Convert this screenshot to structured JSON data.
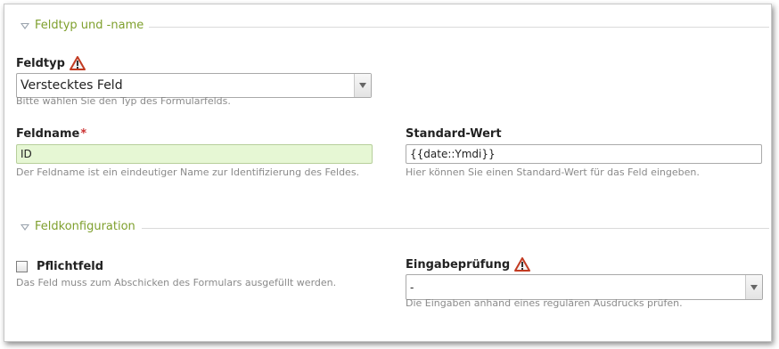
{
  "sections": {
    "feldtyp": {
      "legend": "Feldtyp und -name"
    },
    "konfig": {
      "legend": "Feldkonfiguration"
    }
  },
  "feldtyp": {
    "label": "Feldtyp",
    "value": "Verstecktes Feld",
    "help": "Bitte wählen Sie den Typ des Formularfelds."
  },
  "feldname": {
    "label": "Feldname",
    "required_mark": "*",
    "value": "ID",
    "help": "Der Feldname ist ein eindeutiger Name zur Identifizierung des Feldes."
  },
  "standard": {
    "label": "Standard-Wert",
    "value": "{{date::Ymdi}}",
    "help": "Hier können Sie einen Standard-Wert für das Feld eingeben."
  },
  "pflicht": {
    "label": "Pflichtfeld",
    "checked": false,
    "help": "Das Feld muss zum Abschicken des Formulars ausgefüllt werden."
  },
  "eingabe": {
    "label": "Eingabeprüfung",
    "value": "-",
    "help": "Die Eingaben anhand eines regulären Ausdrucks prüfen."
  },
  "icons": {
    "warning": "warning-icon",
    "legend_toggle": "collapse-triangle-icon",
    "dropdown": "chevron-down-icon"
  },
  "colors": {
    "legend": "#7fa02e",
    "required": "#cc3333",
    "highlight_input": "#e6f7d4"
  }
}
